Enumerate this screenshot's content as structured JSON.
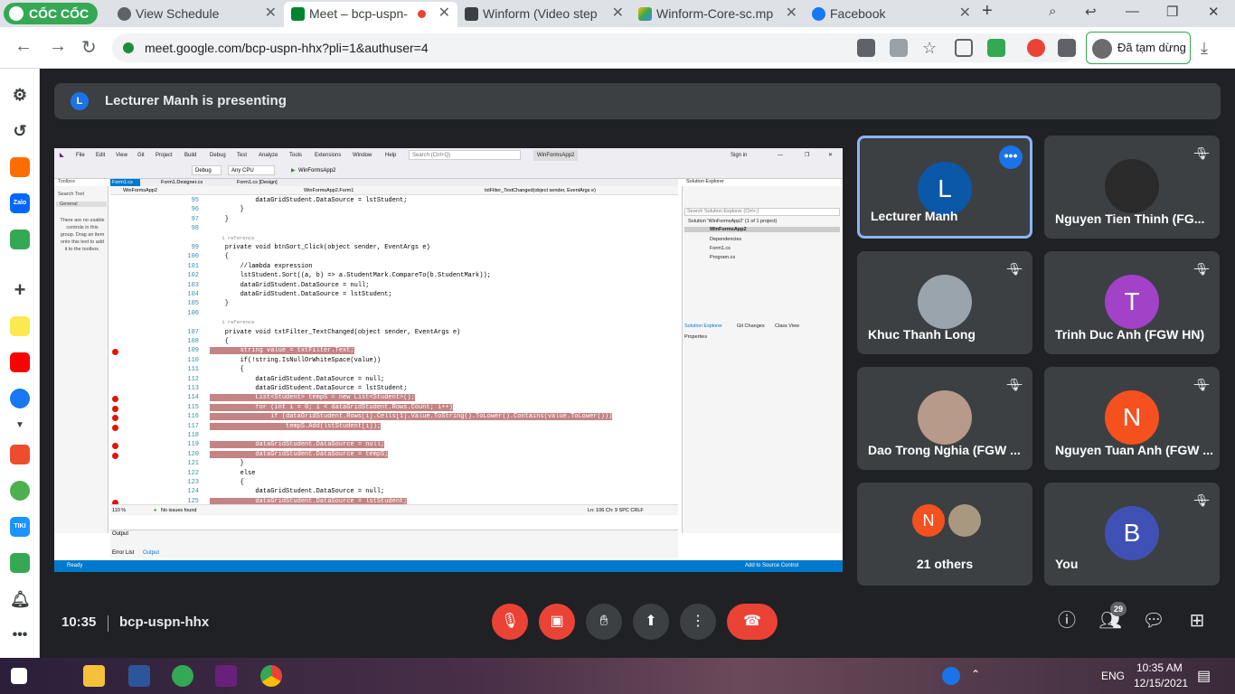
{
  "browser": {
    "logo": "CỐC CỐC",
    "tabs": [
      {
        "title": "View Schedule",
        "icon_color": "#5f6368"
      },
      {
        "title": "Meet – bcp-uspn-",
        "icon_color": "#00832d",
        "active": true
      },
      {
        "title": "Winform (Video step",
        "icon_color": "#3c4043"
      },
      {
        "title": "Winform-Core-sc.mp",
        "icon_color": "#fbbc04"
      },
      {
        "title": "Facebook",
        "icon_color": "#1877f2"
      }
    ],
    "new_tab": "+",
    "url": "meet.google.com/bcp-uspn-hhx?pli=1&authuser=4",
    "profile_status": "Đã tạm dừng"
  },
  "meet": {
    "banner_initial": "L",
    "banner_text": "Lecturer Manh is presenting",
    "time": "10:35",
    "meeting_code": "bcp-uspn-hhx",
    "participant_count": "29",
    "tiles": [
      {
        "name": "Lecturer Manh",
        "initial": "L",
        "color": "#0b57a8",
        "speaking": true
      },
      {
        "name": "Nguyen Tien Thinh (FG...",
        "initial": "",
        "color": "#2a2a2a",
        "photo": true
      },
      {
        "name": "Khuc Thanh Long",
        "initial": "",
        "color": "#9aa4ad",
        "photo": true
      },
      {
        "name": "Trinh Duc Anh (FGW HN)",
        "initial": "T",
        "color": "#a142c7"
      },
      {
        "name": "Dao Trong Nghia (FGW ...",
        "initial": "",
        "color": "#b79a8a",
        "photo": true
      },
      {
        "name": "Nguyen Tuan Anh (FGW ...",
        "initial": "N",
        "color": "#f4511e"
      },
      {
        "name": "21 others",
        "initial": "N",
        "color": "#f4511e"
      },
      {
        "name": "You",
        "initial": "B",
        "color": "#3f51b5"
      }
    ]
  },
  "vs": {
    "menu": [
      "File",
      "Edit",
      "View",
      "Git",
      "Project",
      "Build",
      "Debug",
      "Test",
      "Analyze",
      "Tools",
      "Extensions",
      "Window",
      "Help"
    ],
    "search": "Search (Ctrl+Q)",
    "solution_name": "WinFormsApp2",
    "sign_in": "Sign in",
    "toolbar_config": "Debug",
    "toolbar_cpu": "Any CPU",
    "toolbar_run": "WinFormsApp2",
    "doc_tabs": [
      "Form1.cs",
      "Form1.Designer.cs",
      "Form1.cs [Design]"
    ],
    "nav_bar": [
      "WinFormsApp2",
      "WinFormsApp2.Form1",
      "txtFilter_TextChanged(object sender, EventArgs e)"
    ],
    "toolbox_title": "Toolbox",
    "toolbox_search": "Search Tool",
    "toolbox_group": "General",
    "toolbox_msg": "There are no usable controls in this group. Drag an item onto this text to add it to the toolbox.",
    "code_lines": [
      {
        "n": "95",
        "t": "            dataGridStudent.DataSource = lstStudent;"
      },
      {
        "n": "96",
        "t": "        }"
      },
      {
        "n": "97",
        "t": "    }"
      },
      {
        "n": "98",
        "t": ""
      },
      {
        "n": "",
        "t": "    1 reference"
      },
      {
        "n": "99",
        "t": "    private void btnSort_Click(object sender, EventArgs e)"
      },
      {
        "n": "100",
        "t": "    {"
      },
      {
        "n": "101",
        "t": "        //lambda expression"
      },
      {
        "n": "102",
        "t": "        lstStudent.Sort((a, b) => a.StudentMark.CompareTo(b.StudentMark));"
      },
      {
        "n": "103",
        "t": "        dataGridStudent.DataSource = null;"
      },
      {
        "n": "104",
        "t": "        dataGridStudent.DataSource = lstStudent;"
      },
      {
        "n": "105",
        "t": "    }"
      },
      {
        "n": "106",
        "t": ""
      },
      {
        "n": "",
        "t": "    1 reference"
      },
      {
        "n": "107",
        "t": "    private void txtFilter_TextChanged(object sender, EventArgs e)"
      },
      {
        "n": "108",
        "t": "    {"
      },
      {
        "n": "109",
        "t": "        string value = txtFilter.Text;",
        "bp": true
      },
      {
        "n": "110",
        "t": "        if(!string.IsNullOrWhiteSpace(value))"
      },
      {
        "n": "111",
        "t": "        {"
      },
      {
        "n": "112",
        "t": "            dataGridStudent.DataSource = null;"
      },
      {
        "n": "113",
        "t": "            dataGridStudent.DataSource = lstStudent;"
      },
      {
        "n": "114",
        "t": "            List<Student> tempS = new List<Student>();",
        "bp": true
      },
      {
        "n": "115",
        "t": "            for (int i = 0; i < dataGridStudent.Rows.Count; i++)",
        "bp": true
      },
      {
        "n": "116",
        "t": "                if (dataGridStudent.Rows[i].Cells[1].Value.ToString().ToLower().Contains(value.ToLower()))",
        "bp": true
      },
      {
        "n": "117",
        "t": "                    tempS.Add(lstStudent[i]);",
        "bp": true
      },
      {
        "n": "118",
        "t": ""
      },
      {
        "n": "119",
        "t": "            dataGridStudent.DataSource = null;",
        "bp": true
      },
      {
        "n": "120",
        "t": "            dataGridStudent.DataSource = tempS;",
        "bp": true
      },
      {
        "n": "121",
        "t": "        }"
      },
      {
        "n": "122",
        "t": "        else"
      },
      {
        "n": "123",
        "t": "        {"
      },
      {
        "n": "124",
        "t": "            dataGridStudent.DataSource = null;"
      },
      {
        "n": "125",
        "t": "            dataGridStudent.DataSource = lstStudent;",
        "bp": true
      }
    ],
    "zoom": "110 %",
    "issues": "No issues found",
    "pos": "Ln: 106   Ch: 9   SPC   CRLF",
    "se_title": "Solution Explorer",
    "se_search": "Search Solution Explorer (Ctrl+;)",
    "se_items": [
      "Solution 'WinFormsApp2' (1 of 1 project)",
      "WinFormsApp2",
      "Dependencies",
      "Form1.cs",
      "Program.cs"
    ],
    "se_tabs": [
      "Solution Explorer",
      "Git Changes",
      "Class View"
    ],
    "properties_title": "Properties",
    "output_title": "Output",
    "output_tabs": [
      "Error List",
      "Output"
    ],
    "status_ready": "Ready",
    "status_source": "Add to Source Control"
  },
  "taskbar": {
    "time": "10:35 AM",
    "date": "12/15/2021",
    "lang": "ENG"
  }
}
